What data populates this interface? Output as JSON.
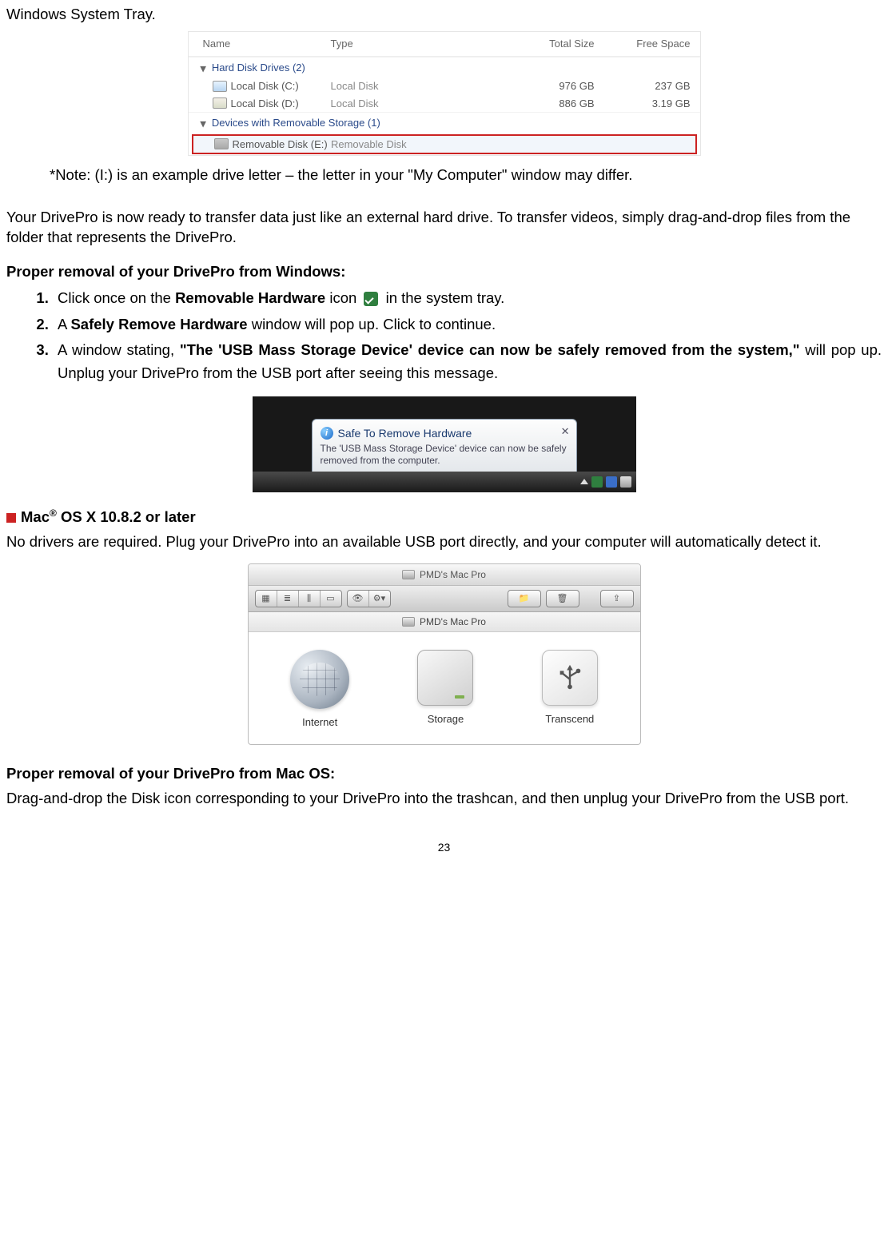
{
  "intro_line": "Windows System Tray.",
  "explorer": {
    "columns": {
      "name": "Name",
      "type": "Type",
      "total": "Total Size",
      "free": "Free Space"
    },
    "groups": [
      {
        "label": "Hard Disk Drives (2)",
        "rows": [
          {
            "name": "Local Disk (C:)",
            "type": "Local Disk",
            "total": "976 GB",
            "free": "237 GB",
            "icon": "c"
          },
          {
            "name": "Local Disk (D:)",
            "type": "Local Disk",
            "total": "886 GB",
            "free": "3.19 GB",
            "icon": "d"
          }
        ]
      },
      {
        "label": "Devices with Removable Storage (1)",
        "rows": [
          {
            "name": "Removable Disk (E:)",
            "type": "Removable Disk",
            "total": "",
            "free": "",
            "icon": "r",
            "highlight": true
          }
        ]
      }
    ]
  },
  "note": "*Note: (I:) is an example drive letter – the letter in your \"My Computer\" window may differ.",
  "ready_para": "Your DrivePro is now ready to transfer data just like an external hard drive. To transfer videos, simply drag-and-drop files from the folder that represents the DrivePro.",
  "win_removal_heading": "Proper removal of your DrivePro from Windows:",
  "steps": {
    "s1a": "Click once on the ",
    "s1b": "Removable Hardware",
    "s1c": " icon ",
    "s1d": " in the system tray.",
    "s2a": "A ",
    "s2b": "Safely Remove Hardware",
    "s2c": " window will pop up. Click to continue.",
    "s3a": "A window stating, ",
    "s3b": "\"The 'USB Mass Storage Device' device can now be safely removed from the system,\"",
    "s3c": " will pop up. Unplug your DrivePro from the USB port after seeing this message."
  },
  "balloon": {
    "title": "Safe To Remove Hardware",
    "body": "The 'USB Mass Storage Device' device can now be safely removed from the computer."
  },
  "mac_heading_a": "Mac",
  "mac_heading_b": " OS X 10.8.2 or later",
  "mac_para": "No drivers are required. Plug your DrivePro into an available USB port directly, and your computer will automatically detect it.",
  "mac_window": {
    "title": "PMD's Mac Pro",
    "path": "PMD's Mac Pro",
    "items": {
      "internet": "Internet",
      "storage": "Storage",
      "transcend": "Transcend"
    }
  },
  "mac_removal_heading": "Proper removal of your DrivePro from Mac OS:",
  "mac_removal_para": "Drag-and-drop the Disk icon corresponding to your DrivePro into the trashcan, and then unplug your DrivePro from the USB port.",
  "page_number": "23"
}
